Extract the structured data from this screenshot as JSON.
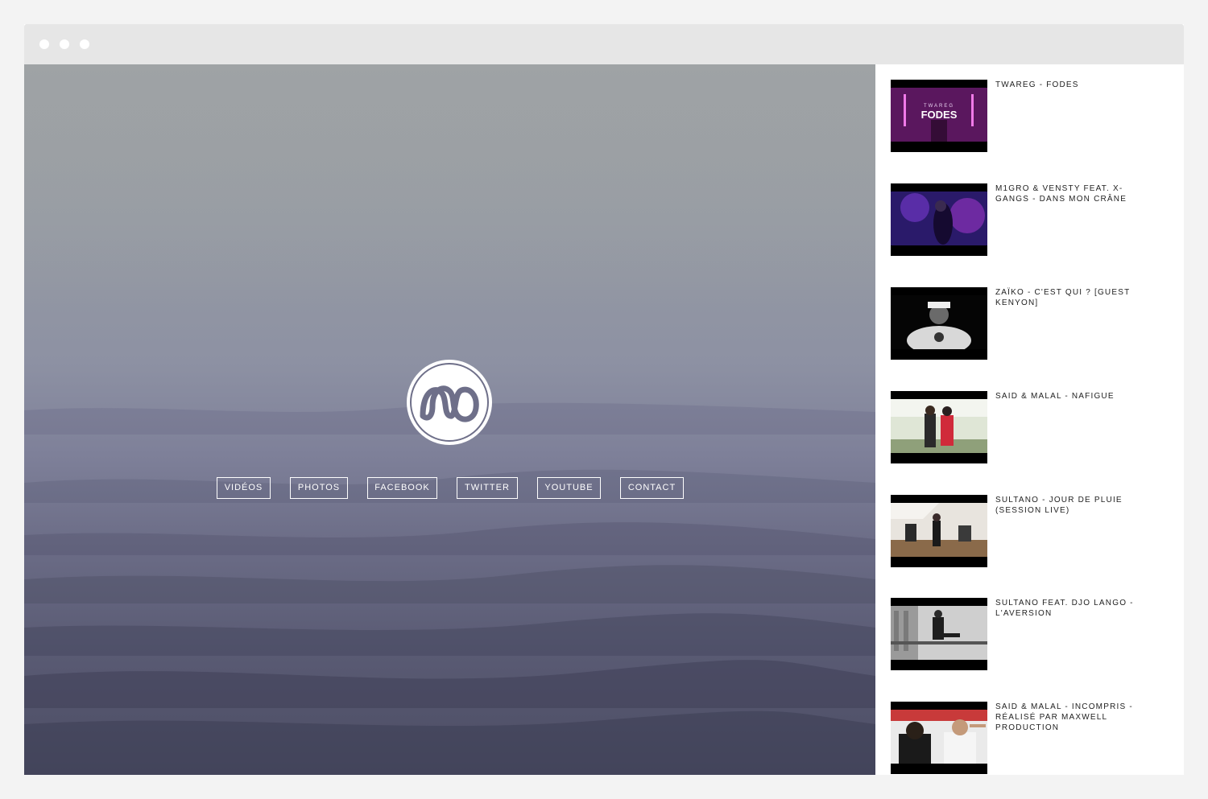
{
  "nav": {
    "videos": "VIDÉOS",
    "photos": "PHOTOS",
    "facebook": "FACEBOOK",
    "twitter": "TWITTER",
    "youtube": "YOUTUBE",
    "contact": "CONTACT"
  },
  "videos": [
    {
      "title": "TWAREG - FODES",
      "thumb_text_small": "TWAREG",
      "thumb_text_big": "FODES"
    },
    {
      "title": "M1GRO & VENSTY FEAT. X-GANGS - DANS MON CRÂNE"
    },
    {
      "title": "ZAÏKO - C'EST QUI ? [GUEST KENYON]"
    },
    {
      "title": "SAID & MALAL - NAFIGUE"
    },
    {
      "title": "SULTANO - JOUR DE PLUIE (SESSION LIVE)"
    },
    {
      "title": "SULTANO FEAT. DJO LANGO - L'AVERSION"
    },
    {
      "title": "SAID & MALAL - INCOMPRIS - RÉALISÉ PAR MAXWELL PRODUCTION"
    }
  ],
  "icons": {
    "logo": "wm-logo-icon"
  }
}
